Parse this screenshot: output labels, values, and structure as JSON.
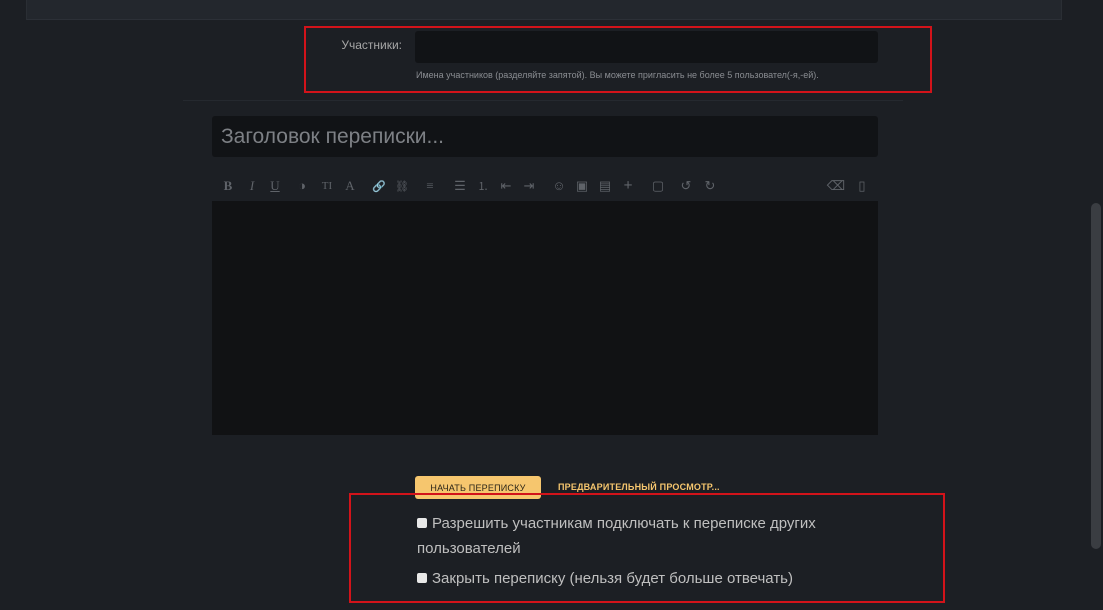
{
  "participants": {
    "label": "Участники:",
    "value": "",
    "hint": "Имена участников (разделяйте запятой). Вы можете пригласить не более 5 пользовател(-я,-ей)."
  },
  "title_field": {
    "placeholder": "Заголовок переписки...",
    "value": ""
  },
  "toolbar": {
    "buttons": [
      {
        "name": "bold-icon",
        "glyph": "B"
      },
      {
        "name": "italic-icon",
        "glyph": "I"
      },
      {
        "name": "underline-icon",
        "glyph": "U"
      },
      {
        "name": "color-icon",
        "glyph": "◑"
      },
      {
        "name": "font-size-icon",
        "glyph": "TI"
      },
      {
        "name": "font-icon",
        "glyph": "A"
      },
      {
        "name": "link-icon",
        "glyph": "🔗"
      },
      {
        "name": "unlink-icon",
        "glyph": "⛓"
      },
      {
        "name": "align-icon",
        "glyph": "≡"
      },
      {
        "name": "bullet-list-icon",
        "glyph": "☰"
      },
      {
        "name": "numbered-list-icon",
        "glyph": "⒈"
      },
      {
        "name": "outdent-icon",
        "glyph": "⇤"
      },
      {
        "name": "indent-icon",
        "glyph": "⇥"
      },
      {
        "name": "smiley-icon",
        "glyph": "☺"
      },
      {
        "name": "image-icon",
        "glyph": "▣"
      },
      {
        "name": "media-icon",
        "glyph": "▤"
      },
      {
        "name": "insert-icon",
        "glyph": "+"
      },
      {
        "name": "save-draft-icon",
        "glyph": "▢"
      },
      {
        "name": "undo-icon",
        "glyph": "↺"
      },
      {
        "name": "redo-icon",
        "glyph": "↻"
      },
      {
        "name": "eraser-icon",
        "glyph": "⌫"
      },
      {
        "name": "source-icon",
        "glyph": "▯"
      }
    ]
  },
  "editor": {
    "value": ""
  },
  "actions": {
    "start_label": "НАЧАТЬ ПЕРЕПИСКУ",
    "preview_label": "ПРЕДВАРИТЕЛЬНЫЙ ПРОСМОТР..."
  },
  "options": {
    "allow_invite_label": "Разрешить участникам подключать к переписке других пользователей",
    "allow_invite_checked": false,
    "lock_label": "Закрыть переписку (нельзя будет больше отвечать)",
    "lock_checked": false
  },
  "colors": {
    "background": "#1c1f24",
    "field": "#111316",
    "accent": "#f6c66e",
    "highlight": "#d2131a"
  }
}
